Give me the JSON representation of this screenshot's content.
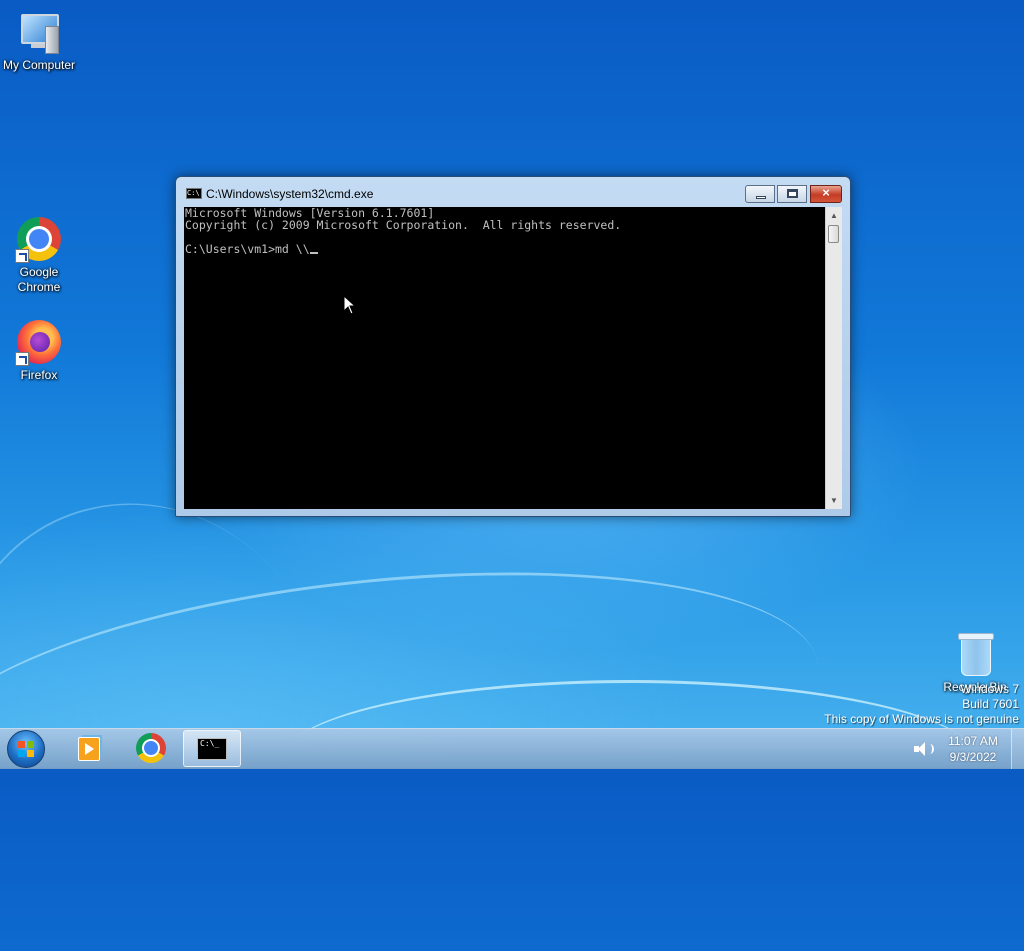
{
  "desktop": {
    "icons": [
      {
        "label": "My Computer",
        "icon": "computer-icon"
      },
      {
        "label": "Google Chrome",
        "icon": "chrome-icon"
      },
      {
        "label": "Firefox",
        "icon": "firefox-icon"
      },
      {
        "label": "Recycle Bin",
        "icon": "recycle-bin-icon"
      }
    ],
    "watermark": {
      "line1": "Windows 7",
      "line2": "Build 7601",
      "line3": "This copy of Windows is not genuine"
    }
  },
  "cmd_window": {
    "title": "C:\\Windows\\system32\\cmd.exe",
    "icon_glyph": "C:\\",
    "lines": [
      "Microsoft Windows [Version 6.1.7601]",
      "Copyright (c) 2009 Microsoft Corporation.  All rights reserved.",
      "",
      "C:\\Users\\vm1>md \\\\"
    ],
    "buttons": {
      "minimize": "minimize",
      "maximize": "maximize",
      "close": "×"
    }
  },
  "taskbar": {
    "start": "Start",
    "pinned": [
      {
        "name": "Windows Media Player",
        "icon": "media-player-icon"
      },
      {
        "name": "Google Chrome",
        "icon": "chrome-icon"
      },
      {
        "name": "Command Prompt",
        "icon": "cmd-icon",
        "glyph": "C:\\_"
      }
    ],
    "clock": {
      "time": "11:07 AM",
      "date": "9/3/2022"
    }
  },
  "colors": {
    "console_bg": "#000000",
    "console_fg": "#c0c0c0",
    "close_button": "#c53b23",
    "desktop_blue": "#1178d8"
  }
}
